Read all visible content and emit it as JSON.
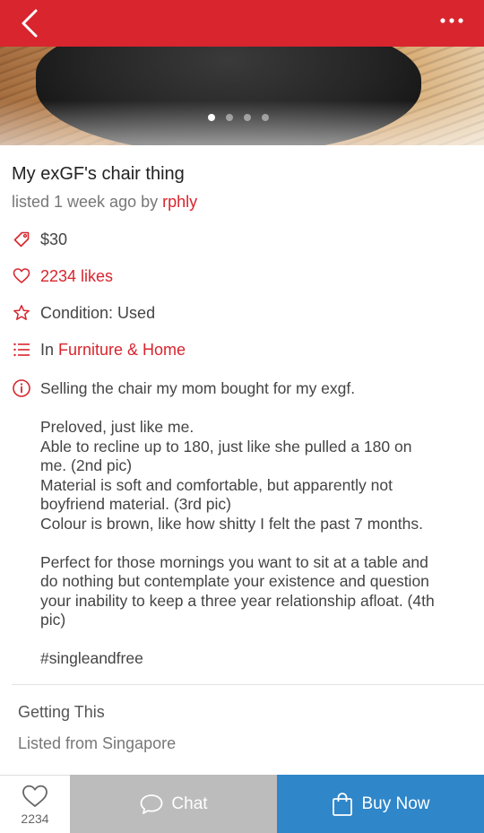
{
  "header": {
    "back_icon": "chevron-left-icon",
    "menu_icon": "more-dots-icon",
    "color": "#d8252e"
  },
  "gallery": {
    "image_count": 4,
    "active_index": 0
  },
  "listing": {
    "title": "My exGF's chair thing",
    "listed_prefix": "listed 1 week ago by ",
    "seller": "rphly",
    "price": "$30",
    "likes": "2234 likes",
    "condition": "Condition: Used",
    "category_prefix": "In ",
    "category": "Furniture & Home",
    "description": {
      "line1": "Selling the chair my mom bought for my exgf.",
      "para2": [
        "Preloved, just like me.",
        "Able to recline up to 180, just like she pulled a 180 on",
        "me. (2nd pic)",
        "Material is soft and comfortable, but apparently not",
        "boyfriend material. (3rd pic)",
        "Colour is brown, like how shitty I felt the past 7 months."
      ],
      "para3": [
        "Perfect for those mornings you want to sit at a table and",
        "do nothing but contemplate your existence and question",
        "your inability to keep a three year relationship afloat. (4th",
        "pic)"
      ],
      "hashtag": "#singleandfree"
    }
  },
  "getting": {
    "heading": "Getting This",
    "location": "Listed from Singapore"
  },
  "bottom_bar": {
    "like_count": "2234",
    "chat_label": "Chat",
    "buy_label": "Buy Now",
    "chat_color": "#bcbcbc",
    "buy_color": "#2f86c9"
  }
}
